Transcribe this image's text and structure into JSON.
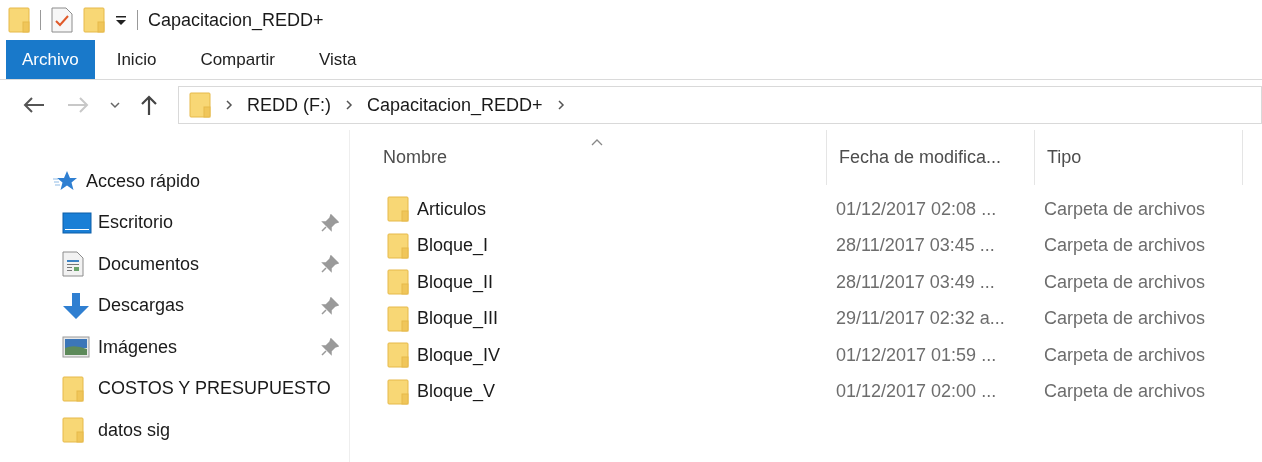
{
  "window": {
    "title": "Capacitacion_REDD+"
  },
  "ribbon_tabs": [
    {
      "label": "Archivo",
      "selected": true
    },
    {
      "label": "Inicio",
      "selected": false
    },
    {
      "label": "Compartir",
      "selected": false
    },
    {
      "label": "Vista",
      "selected": false
    }
  ],
  "address_bar": {
    "crumbs": [
      "REDD (F:)",
      "Capacitacion_REDD+"
    ]
  },
  "sidebar": {
    "header": "Acceso rápido",
    "items": [
      {
        "label": "Escritorio",
        "kind": "desktop",
        "pinned": true
      },
      {
        "label": "Documentos",
        "kind": "documents",
        "pinned": true
      },
      {
        "label": "Descargas",
        "kind": "downloads",
        "pinned": true
      },
      {
        "label": "Imágenes",
        "kind": "pictures",
        "pinned": true
      },
      {
        "label": "COSTOS Y PRESUPUESTO",
        "kind": "folder",
        "pinned": false
      },
      {
        "label": "datos sig",
        "kind": "folder",
        "pinned": false
      }
    ]
  },
  "table": {
    "columns": [
      "Nombre",
      "Fecha de modifica...",
      "Tipo"
    ],
    "rows": [
      {
        "name": "Articulos",
        "date": "01/12/2017 02:08 ...",
        "type": "Carpeta de archivos"
      },
      {
        "name": "Bloque_I",
        "date": "28/11/2017 03:45 ...",
        "type": "Carpeta de archivos"
      },
      {
        "name": "Bloque_II",
        "date": "28/11/2017 03:49 ...",
        "type": "Carpeta de archivos"
      },
      {
        "name": "Bloque_III",
        "date": "29/11/2017 02:32 a...",
        "type": "Carpeta de archivos"
      },
      {
        "name": "Bloque_IV",
        "date": "01/12/2017 01:59 ...",
        "type": "Carpeta de archivos"
      },
      {
        "name": "Bloque_V",
        "date": "01/12/2017 02:00 ...",
        "type": "Carpeta de archivos"
      }
    ]
  }
}
